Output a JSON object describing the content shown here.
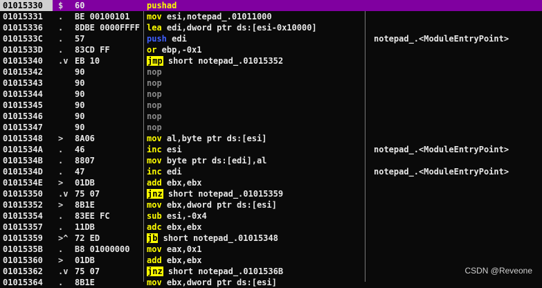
{
  "colors": {
    "background": "#0a0a0a",
    "selected_row": "#8000a0",
    "mnemonic": "#ffff00",
    "push_mnemonic": "#4060ff",
    "jump_highlight": "#ffff00",
    "nop": "#8a8a8a"
  },
  "rows": [
    {
      "addr": "01015330",
      "arrow": "$",
      "bytes": "60",
      "mnem": "pushad",
      "ops": "",
      "cmt": "",
      "kind": "plain",
      "selected": true
    },
    {
      "addr": "01015331",
      "arrow": ".",
      "bytes": "BE 00100101",
      "mnem": "mov",
      "ops": " esi,notepad_.01011000",
      "cmt": "",
      "kind": "plain",
      "selected": false
    },
    {
      "addr": "01015336",
      "arrow": ".",
      "bytes": "8DBE 0000FFFF",
      "mnem": "lea",
      "ops": " edi,dword ptr ds:[esi-0x10000]",
      "cmt": "",
      "kind": "plain",
      "selected": false
    },
    {
      "addr": "0101533C",
      "arrow": ".",
      "bytes": "57",
      "mnem": "push",
      "ops": " edi",
      "cmt": "notepad_.<ModuleEntryPoint>",
      "kind": "push",
      "selected": false
    },
    {
      "addr": "0101533D",
      "arrow": ".",
      "bytes": "83CD FF",
      "mnem": "or",
      "ops": " ebp,-0x1",
      "cmt": "",
      "kind": "plain",
      "selected": false
    },
    {
      "addr": "01015340",
      "arrow": ".v",
      "bytes": "EB 10",
      "mnem": "jmp",
      "ops": " short notepad_.01015352",
      "cmt": "",
      "kind": "jump",
      "selected": false
    },
    {
      "addr": "01015342",
      "arrow": "",
      "bytes": "90",
      "mnem": "nop",
      "ops": "",
      "cmt": "",
      "kind": "nop",
      "selected": false
    },
    {
      "addr": "01015343",
      "arrow": "",
      "bytes": "90",
      "mnem": "nop",
      "ops": "",
      "cmt": "",
      "kind": "nop",
      "selected": false
    },
    {
      "addr": "01015344",
      "arrow": "",
      "bytes": "90",
      "mnem": "nop",
      "ops": "",
      "cmt": "",
      "kind": "nop",
      "selected": false
    },
    {
      "addr": "01015345",
      "arrow": "",
      "bytes": "90",
      "mnem": "nop",
      "ops": "",
      "cmt": "",
      "kind": "nop",
      "selected": false
    },
    {
      "addr": "01015346",
      "arrow": "",
      "bytes": "90",
      "mnem": "nop",
      "ops": "",
      "cmt": "",
      "kind": "nop",
      "selected": false
    },
    {
      "addr": "01015347",
      "arrow": "",
      "bytes": "90",
      "mnem": "nop",
      "ops": "",
      "cmt": "",
      "kind": "nop",
      "selected": false
    },
    {
      "addr": "01015348",
      "arrow": ">",
      "bytes": "8A06",
      "mnem": "mov",
      "ops": " al,byte ptr ds:[esi]",
      "cmt": "",
      "kind": "plain",
      "selected": false
    },
    {
      "addr": "0101534A",
      "arrow": ".",
      "bytes": "46",
      "mnem": "inc",
      "ops": " esi",
      "cmt": "notepad_.<ModuleEntryPoint>",
      "kind": "plain",
      "selected": false
    },
    {
      "addr": "0101534B",
      "arrow": ".",
      "bytes": "8807",
      "mnem": "mov",
      "ops": " byte ptr ds:[edi],al",
      "cmt": "",
      "kind": "plain",
      "selected": false
    },
    {
      "addr": "0101534D",
      "arrow": ".",
      "bytes": "47",
      "mnem": "inc",
      "ops": " edi",
      "cmt": "notepad_.<ModuleEntryPoint>",
      "kind": "plain",
      "selected": false
    },
    {
      "addr": "0101534E",
      "arrow": ">",
      "bytes": "01DB",
      "mnem": "add",
      "ops": " ebx,ebx",
      "cmt": "",
      "kind": "plain",
      "selected": false
    },
    {
      "addr": "01015350",
      "arrow": ".v",
      "bytes": "75 07",
      "mnem": "jnz",
      "ops": " short notepad_.01015359",
      "cmt": "",
      "kind": "jump",
      "selected": false
    },
    {
      "addr": "01015352",
      "arrow": ">",
      "bytes": "8B1E",
      "mnem": "mov",
      "ops": " ebx,dword ptr ds:[esi]",
      "cmt": "",
      "kind": "plain",
      "selected": false
    },
    {
      "addr": "01015354",
      "arrow": ".",
      "bytes": "83EE FC",
      "mnem": "sub",
      "ops": " esi,-0x4",
      "cmt": "",
      "kind": "plain",
      "selected": false
    },
    {
      "addr": "01015357",
      "arrow": ".",
      "bytes": "11DB",
      "mnem": "adc",
      "ops": " ebx,ebx",
      "cmt": "",
      "kind": "plain",
      "selected": false
    },
    {
      "addr": "01015359",
      "arrow": ">^",
      "bytes": "72 ED",
      "mnem": "jb",
      "ops": " short notepad_.01015348",
      "cmt": "",
      "kind": "jump",
      "selected": false
    },
    {
      "addr": "0101535B",
      "arrow": ".",
      "bytes": "B8 01000000",
      "mnem": "mov",
      "ops": " eax,0x1",
      "cmt": "",
      "kind": "plain",
      "selected": false
    },
    {
      "addr": "01015360",
      "arrow": ">",
      "bytes": "01DB",
      "mnem": "add",
      "ops": " ebx,ebx",
      "cmt": "",
      "kind": "plain",
      "selected": false
    },
    {
      "addr": "01015362",
      "arrow": ".v",
      "bytes": "75 07",
      "mnem": "jnz",
      "ops": " short notepad_.0101536B",
      "cmt": "",
      "kind": "jump",
      "selected": false
    },
    {
      "addr": "01015364",
      "arrow": ".",
      "bytes": "8B1E",
      "mnem": "mov",
      "ops": " ebx,dword ptr ds:[esi]",
      "cmt": "",
      "kind": "plain",
      "selected": false
    }
  ],
  "watermark": "CSDN @Reveone"
}
